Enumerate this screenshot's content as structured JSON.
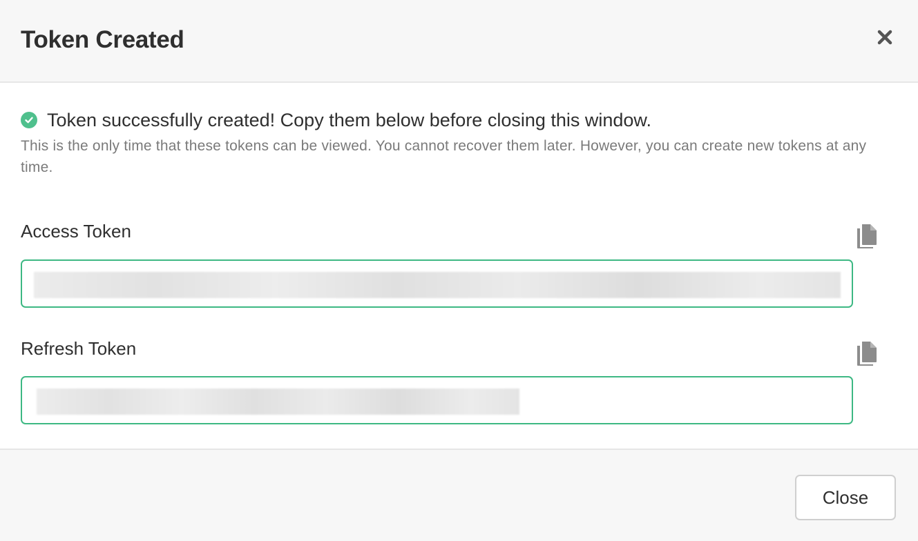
{
  "dialog": {
    "title": "Token Created",
    "close_icon": "close-icon"
  },
  "message": {
    "success_icon": "check-circle-icon",
    "success": "Token successfully created! Copy them below before closing this window.",
    "hint": "This is the only time that these tokens can be viewed. You cannot recover them later. However, you can create new tokens at any time."
  },
  "fields": {
    "access": {
      "label": "Access Token",
      "copy_icon": "copy-icon",
      "value": "",
      "value_state": "blurred"
    },
    "refresh": {
      "label": "Refresh Token",
      "copy_icon": "copy-icon",
      "value": "",
      "value_state": "blurred"
    }
  },
  "footer": {
    "close_label": "Close"
  },
  "colors": {
    "success": "#4fc08d",
    "input_border": "#3db883",
    "hint_text": "#7a7a7a",
    "header_bg": "#f7f7f7"
  }
}
